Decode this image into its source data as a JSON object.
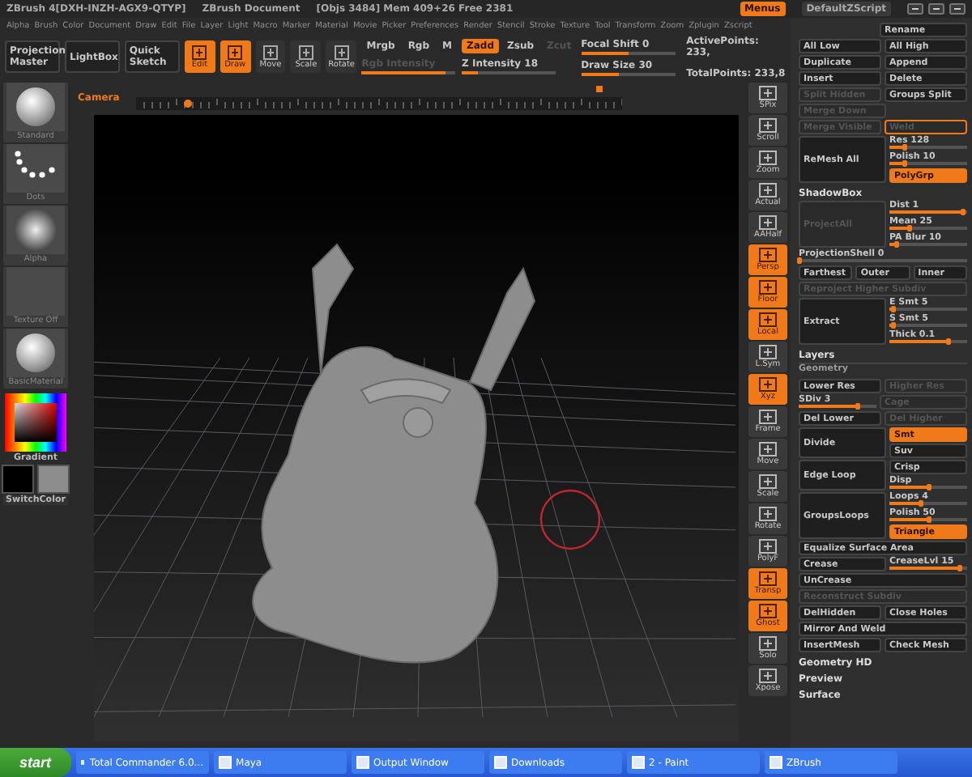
{
  "title_bar": {
    "app": "ZBrush 4[DXH-INZH-AGX9-QTYP]",
    "document": "ZBrush Document",
    "stats": "[Objs 3484] Mem 409+26 Free 2381",
    "buttons": [
      {
        "label": "Menus",
        "selected": true
      },
      {
        "label": "DefaultZScript",
        "selected": false
      }
    ]
  },
  "menu": [
    "Alpha",
    "Brush",
    "Color",
    "Document",
    "Draw",
    "Edit",
    "File",
    "Layer",
    "Light",
    "Macro",
    "Marker",
    "Material",
    "Movie",
    "Picker",
    "Preferences",
    "Render",
    "Stencil",
    "Stroke",
    "Texture",
    "Tool",
    "Transform",
    "Zoom",
    "Zplugin",
    "Zscript"
  ],
  "toolbar": {
    "items": [
      {
        "kind": "big",
        "label": "Projection Master",
        "selected": false
      },
      {
        "kind": "big",
        "label": "LightBox",
        "selected": false
      },
      {
        "kind": "big",
        "label": "Quick Sketch",
        "selected": false
      },
      {
        "kind": "mode",
        "label": "Edit",
        "selected": true
      },
      {
        "kind": "mode",
        "label": "Draw",
        "selected": true
      },
      {
        "kind": "mode",
        "label": "Move",
        "selected": false
      },
      {
        "kind": "mode",
        "label": "Scale",
        "selected": false
      },
      {
        "kind": "mode",
        "label": "Rotate",
        "selected": false
      }
    ],
    "color_modes": [
      {
        "label": "Mrgb",
        "on": false,
        "disabled": false
      },
      {
        "label": "Rgb",
        "on": false,
        "disabled": false
      },
      {
        "label": "M",
        "on": false,
        "disabled": false
      }
    ],
    "rgb_intensity": {
      "label": "Rgb Intensity",
      "level": 0.9,
      "disabled": true
    },
    "z_modes": [
      {
        "label": "Zadd",
        "on": true,
        "disabled": false
      },
      {
        "label": "Zsub",
        "on": false,
        "disabled": false
      },
      {
        "label": "Zcut",
        "on": false,
        "disabled": true
      }
    ],
    "z_intensity": {
      "label": "Z Intensity 18",
      "level": 0.18,
      "disabled": false
    },
    "focal_shift": {
      "label": "Focal Shift 0",
      "level": 0.5,
      "disabled": false
    },
    "draw_size": {
      "label": "Draw Size 30",
      "level": 0.4,
      "disabled": false
    },
    "active_points": "ActivePoints: 233,",
    "total_points": "TotalPoints: 233,8"
  },
  "camera": {
    "label": "Camera"
  },
  "left_tray": {
    "thumbs": [
      {
        "kind": "sphere",
        "label": "Standard"
      },
      {
        "kind": "dots",
        "label": "Dots"
      },
      {
        "kind": "glow",
        "label": "Alpha"
      },
      {
        "kind": "blank",
        "label": "Texture Off"
      },
      {
        "kind": "sphere",
        "label": "BasicMaterial"
      }
    ],
    "gradient_label": "Gradient",
    "switch_label": "SwitchColor"
  },
  "shelf": [
    {
      "label": "SPix",
      "on": false
    },
    {
      "label": "Scroll",
      "on": false
    },
    {
      "label": "Zoom",
      "on": false
    },
    {
      "label": "Actual",
      "on": false
    },
    {
      "label": "AAHalf",
      "on": false
    },
    {
      "label": "Persp",
      "on": true
    },
    {
      "label": "Floor",
      "on": true
    },
    {
      "label": "Local",
      "on": true
    },
    {
      "label": "L.Sym",
      "on": false
    },
    {
      "label": "Xyz",
      "on": true
    },
    {
      "label": "Frame",
      "on": false
    },
    {
      "label": "Move",
      "on": false
    },
    {
      "label": "Scale",
      "on": false
    },
    {
      "label": "Rotate",
      "on": false
    },
    {
      "label": "PolyF",
      "on": false
    },
    {
      "label": "Transp",
      "on": true
    },
    {
      "label": "Ghost",
      "on": true
    },
    {
      "label": "Solo",
      "on": false
    },
    {
      "label": "Xpose",
      "on": false
    }
  ],
  "panel": {
    "rows": [
      {
        "cells": [
          {
            "kind": "spacer"
          },
          {
            "kind": "button",
            "label": "Rename",
            "disabled": false
          }
        ]
      },
      {
        "cells": [
          {
            "kind": "button",
            "label": "All Low",
            "disabled": false
          },
          {
            "kind": "button",
            "label": "All High",
            "disabled": false
          }
        ]
      },
      {
        "cells": [
          {
            "kind": "button",
            "label": "Duplicate",
            "disabled": false
          },
          {
            "kind": "button",
            "label": "Append",
            "disabled": false
          }
        ]
      },
      {
        "cells": [
          {
            "kind": "button",
            "label": "Insert",
            "disabled": false
          },
          {
            "kind": "button",
            "label": "Delete",
            "disabled": false
          }
        ]
      },
      {
        "cells": [
          {
            "kind": "button",
            "label": "Split Hidden",
            "disabled": true
          },
          {
            "kind": "button",
            "label": "Groups Split",
            "disabled": false
          }
        ]
      },
      {
        "cells": [
          {
            "kind": "button",
            "label": "Merge Down",
            "disabled": true
          },
          {
            "kind": "spacer"
          }
        ]
      },
      {
        "cells": [
          {
            "kind": "button",
            "label": "Merge Visible",
            "disabled": true
          },
          {
            "kind": "toggle",
            "label": "Weld",
            "on": true,
            "disabled": true
          }
        ]
      },
      {
        "cells": [
          {
            "kind": "button",
            "label": "ReMesh All",
            "disabled": false
          },
          {
            "kind": "stack",
            "cells": [
              {
                "kind": "slider",
                "label": "Res 128",
                "level": 0.2
              },
              {
                "kind": "slider",
                "label": "Polish 10",
                "level": 0.2
              },
              {
                "kind": "toggle",
                "label": "PolyGrp",
                "on": true,
                "disabled": false
              }
            ]
          }
        ]
      },
      {
        "cells": [
          {
            "kind": "heading",
            "label": "ShadowBox"
          }
        ]
      },
      {
        "cells": [
          {
            "kind": "button",
            "label": "ProjectAll",
            "disabled": true
          },
          {
            "kind": "stack",
            "cells": [
              {
                "kind": "slider",
                "label": "Dist 1",
                "level": 0.95
              },
              {
                "kind": "slider",
                "label": "Mean 25",
                "level": 0.25
              },
              {
                "kind": "slider",
                "label": "PA Blur 10",
                "level": 0.1
              }
            ]
          }
        ]
      },
      {
        "cells": [
          {
            "kind": "slider",
            "label": "ProjectionShell 0",
            "level": 0
          }
        ]
      },
      {
        "cells": [
          {
            "kind": "button",
            "label": "Farthest",
            "disabled": false
          },
          {
            "kind": "button",
            "label": "Outer",
            "disabled": false
          },
          {
            "kind": "button",
            "label": "Inner",
            "disabled": false
          }
        ]
      },
      {
        "cells": [
          {
            "kind": "button",
            "label": "Reproject Higher Subdiv",
            "disabled": true
          }
        ]
      },
      {
        "cells": [
          {
            "kind": "button",
            "label": "Extract",
            "disabled": false
          },
          {
            "kind": "stack",
            "cells": [
              {
                "kind": "slider",
                "label": "E Smt 5",
                "level": 0.05
              },
              {
                "kind": "slider",
                "label": "S Smt 5",
                "level": 0.05
              },
              {
                "kind": "slider",
                "label": "Thick 0.1",
                "level": 0.75
              }
            ]
          }
        ]
      },
      {
        "cells": [
          {
            "kind": "heading",
            "label": "Layers"
          }
        ]
      },
      {
        "cells": [
          {
            "kind": "group",
            "label": "Geometry"
          }
        ]
      },
      {
        "cells": [
          {
            "kind": "button",
            "label": "Lower Res",
            "disabled": false
          },
          {
            "kind": "button",
            "label": "Higher Res",
            "disabled": true
          }
        ]
      },
      {
        "cells": [
          {
            "kind": "slider",
            "label": "SDiv 3",
            "level": 0.75
          },
          {
            "kind": "button",
            "label": "Cage",
            "disabled": true
          }
        ]
      },
      {
        "cells": [
          {
            "kind": "button",
            "label": "Del Lower",
            "disabled": false
          },
          {
            "kind": "button",
            "label": "Del Higher",
            "disabled": true
          }
        ]
      },
      {
        "cells": [
          {
            "kind": "button",
            "label": "Divide",
            "disabled": false
          },
          {
            "kind": "stack",
            "cells": [
              {
                "kind": "toggle",
                "label": "Smt",
                "on": true,
                "disabled": false
              },
              {
                "kind": "toggle",
                "label": "Suv",
                "on": false,
                "disabled": false
              }
            ]
          }
        ]
      },
      {
        "cells": [
          {
            "kind": "button",
            "label": "Edge Loop",
            "disabled": false
          },
          {
            "kind": "stack",
            "cells": [
              {
                "kind": "toggle",
                "label": "Crisp",
                "on": false,
                "disabled": false
              },
              {
                "kind": "slider",
                "label": "Disp",
                "level": 0.5
              }
            ]
          }
        ]
      },
      {
        "cells": [
          {
            "kind": "button",
            "label": "GroupsLoops",
            "disabled": false
          },
          {
            "kind": "stack",
            "cells": [
              {
                "kind": "slider",
                "label": "Loops 4",
                "level": 0.4
              },
              {
                "kind": "slider",
                "label": "Polish 50",
                "level": 0.5
              },
              {
                "kind": "toggle",
                "label": "Triangle",
                "on": true,
                "disabled": false
              }
            ]
          }
        ]
      },
      {
        "cells": [
          {
            "kind": "button",
            "label": "Equalize Surface Area",
            "disabled": false
          }
        ]
      },
      {
        "cells": [
          {
            "kind": "button",
            "label": "Crease",
            "disabled": false
          },
          {
            "kind": "slider",
            "label": "CreaseLvl 15",
            "level": 0.9
          }
        ]
      },
      {
        "cells": [
          {
            "kind": "button",
            "label": "UnCrease",
            "disabled": false
          }
        ]
      },
      {
        "cells": [
          {
            "kind": "button",
            "label": "Reconstruct Subdiv",
            "disabled": true
          }
        ]
      },
      {
        "cells": [
          {
            "kind": "button",
            "label": "DelHidden",
            "disabled": false
          },
          {
            "kind": "button",
            "label": "Close Holes",
            "disabled": false
          }
        ]
      },
      {
        "cells": [
          {
            "kind": "button",
            "label": "Mirror And Weld",
            "disabled": false
          }
        ]
      },
      {
        "cells": [
          {
            "kind": "button",
            "label": "InsertMesh",
            "disabled": false
          },
          {
            "kind": "button",
            "label": "Check Mesh",
            "disabled": false
          }
        ]
      },
      {
        "cells": [
          {
            "kind": "heading",
            "label": "Geometry HD"
          }
        ]
      },
      {
        "cells": [
          {
            "kind": "heading",
            "label": "Preview"
          }
        ]
      },
      {
        "cells": [
          {
            "kind": "heading",
            "label": "Surface"
          }
        ]
      }
    ]
  },
  "taskbar": {
    "start": "start",
    "tasks": [
      "Total Commander 6.0...",
      "Maya",
      "Output Window",
      "Downloads",
      "2 - Paint",
      "ZBrush"
    ]
  }
}
